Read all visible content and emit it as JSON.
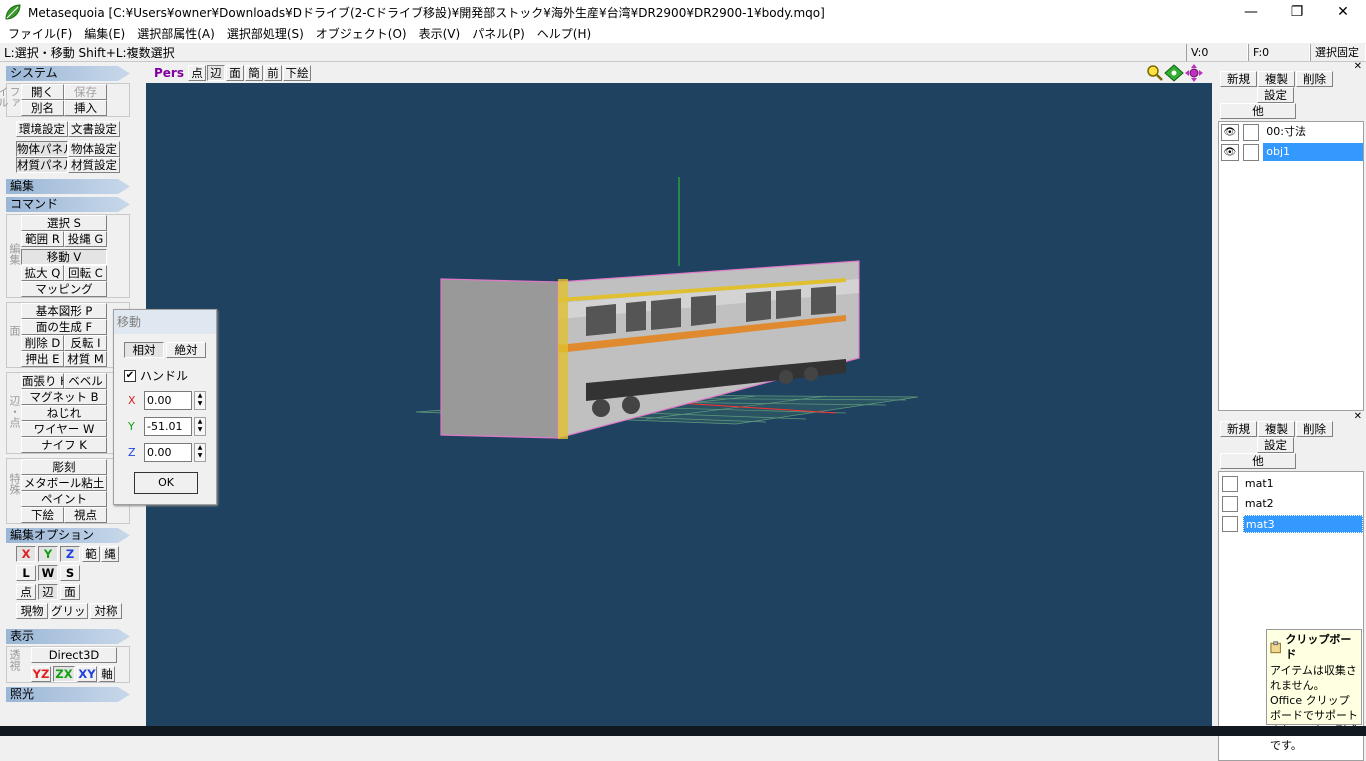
{
  "title": "Metasequoia [C:¥Users¥owner¥Downloads¥Dドライブ(2-Cドライブ移設)¥開発部ストック¥海外生産¥台湾¥DR2900¥DR2900-1¥body.mqo]",
  "window_controls": {
    "minimize": "—",
    "maximize": "❐",
    "close": "✕"
  },
  "menu": [
    "ファイル(F)",
    "編集(E)",
    "選択部属性(A)",
    "選択部処理(S)",
    "オブジェクト(O)",
    "表示(V)",
    "パネル(P)",
    "ヘルプ(H)"
  ],
  "status": {
    "hint": "L:選択・移動  Shift+L:複数選択",
    "v": "V:0",
    "f": "F:0",
    "lock": "選択固定"
  },
  "left": {
    "system_header": "システム",
    "file_label": "ファイル",
    "open": "開く",
    "save": "保存",
    "alias": "別名",
    "insert": "挿入",
    "env_settings": "環境設定",
    "doc_settings": "文書設定",
    "object_panel": "物体パネル",
    "object_settings": "物体設定",
    "material_panel": "材質パネル",
    "material_settings": "材質設定",
    "edit_header": "編集",
    "command_header": "コマンド",
    "edit_label": "編集",
    "select": "選択 S",
    "range": "範囲 R",
    "lasso": "投縄 G",
    "move": "移動 V",
    "scale": "拡大 Q",
    "rotate": "回転 C",
    "mapping": "マッピング",
    "face_label": "面",
    "primitive": "基本図形 P",
    "face_gen": "面の生成 F",
    "delete": "削除 D",
    "flip": "反転 I",
    "extrude": "押出 E",
    "material_m": "材質 M",
    "edge_label": "辺・点",
    "stretch": "面張り H",
    "bevel": "ベベル",
    "magnet": "マグネット B",
    "twist": "ねじれ",
    "wire": "ワイヤー W",
    "knife": "ナイフ K",
    "special_label": "特殊",
    "sculpt": "彫刻",
    "metaball": "メタボール粘土",
    "paint": "ペイント",
    "underlay": "下絵",
    "viewpoint": "視点",
    "edit_option_header": "編集オプション",
    "opt_x": "X",
    "opt_y": "Y",
    "opt_z": "Z",
    "opt_range": "範",
    "opt_rope": "縄",
    "opt_l": "L",
    "opt_w": "W",
    "opt_s": "S",
    "opt_point": "点",
    "opt_edge": "辺",
    "opt_face": "面",
    "opt_current": "現物",
    "opt_grid": "グリッド",
    "opt_symmetry": "対称",
    "display_header": "表示",
    "perspective_label": "透視",
    "direct3d": "Direct3D",
    "yz": "YZ",
    "zx": "ZX",
    "xy": "XY",
    "axis": "軸",
    "lighting_header": "照光"
  },
  "view": {
    "pers": "Pers",
    "buttons": [
      "点",
      "辺",
      "面",
      "簡",
      "前",
      "下絵"
    ]
  },
  "move_dialog": {
    "title": "移動",
    "tab_relative": "相対",
    "tab_absolute": "絶対",
    "handle_label": "ハンドル",
    "handle_checked": "✔",
    "x_label": "X",
    "x": "0.00",
    "y_label": "Y",
    "y": "-51.01",
    "z_label": "Z",
    "z": "0.00",
    "ok": "OK"
  },
  "object_panel": {
    "new": "新規",
    "copy": "複製",
    "delete": "削除",
    "settings": "設定",
    "other": "他",
    "eye": "👁",
    "items": [
      "00:寸法",
      "obj1"
    ]
  },
  "material_panel": {
    "new": "新規",
    "copy": "複製",
    "delete": "削除",
    "settings": "設定",
    "other": "他",
    "items": [
      "mat1",
      "mat2",
      "mat3"
    ]
  },
  "clipboard": {
    "title": "クリップボード",
    "text": "アイテムは収集されません。 Office クリップボードでサポートされていない形式です。"
  },
  "colors": {
    "viewport": "#1e4260",
    "selection": "#3399ff",
    "axis_x": "#ff3030",
    "axis_y": "#30d030"
  }
}
